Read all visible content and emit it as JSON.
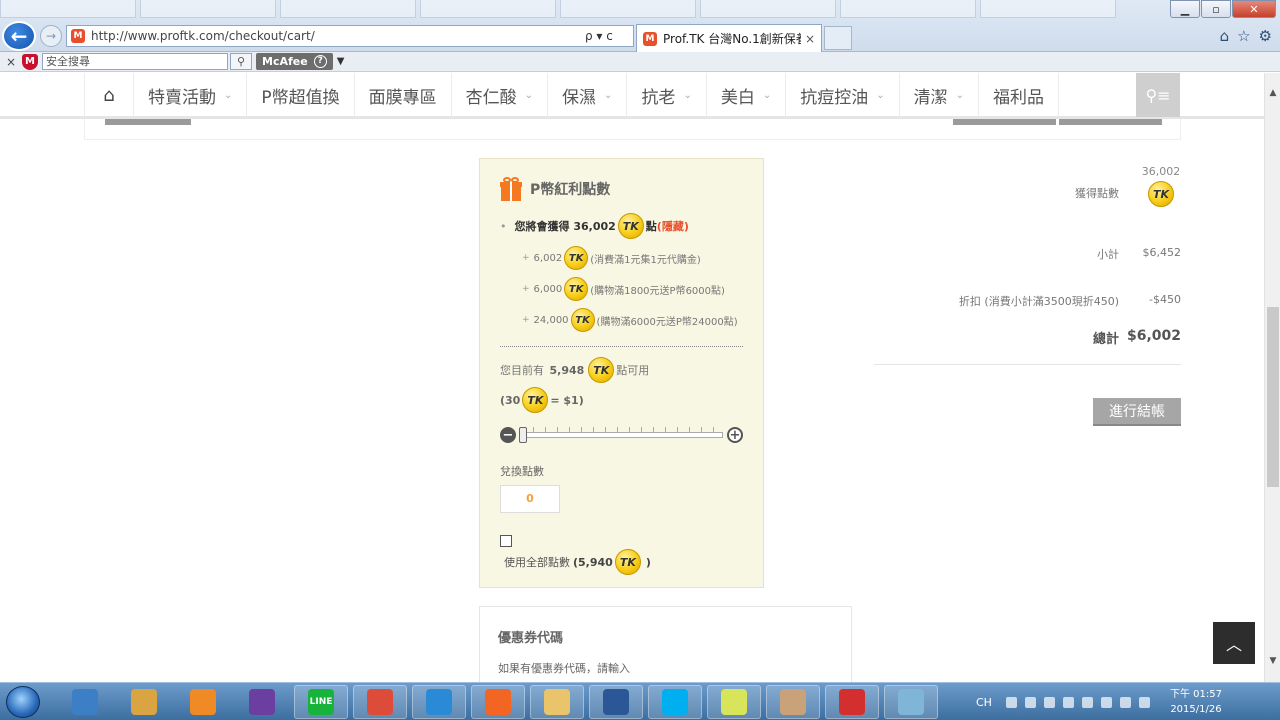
{
  "browser": {
    "address_url": "http://www.proftk.com/checkout/cart/",
    "address_controls": "ρ ▾ c",
    "tab_title": "Prof.TK 台灣No.1創新保養...",
    "tab_close": "×",
    "toolbar_close": "×",
    "safe_search_placeholder": "安全搜尋",
    "mcafee_label": "McAfee",
    "window_controls": {
      "minimize": "▁",
      "maximize": "▫",
      "close": "✕"
    },
    "tool_icons": [
      "home-icon",
      "star-icon",
      "gear-icon"
    ]
  },
  "site_nav": {
    "items": [
      {
        "label": "特賣活動",
        "has_dropdown": true
      },
      {
        "label": "P幣超值換",
        "has_dropdown": false
      },
      {
        "label": "面膜專區",
        "has_dropdown": false
      },
      {
        "label": "杏仁酸",
        "has_dropdown": true
      },
      {
        "label": "保濕",
        "has_dropdown": true
      },
      {
        "label": "抗老",
        "has_dropdown": true
      },
      {
        "label": "美白",
        "has_dropdown": true
      },
      {
        "label": "抗痘控油",
        "has_dropdown": true
      },
      {
        "label": "清潔",
        "has_dropdown": true
      },
      {
        "label": "福利品",
        "has_dropdown": false
      }
    ]
  },
  "coin_text": "TK",
  "points": {
    "title": "P幣紅利點數",
    "earn_prefix": "您將會獲得",
    "earn_amount": "36,002",
    "earn_unit": "點",
    "hide_open": "(",
    "hide_link": "隱藏",
    "hide_close": ")",
    "breakdown": [
      {
        "amount": "6,002",
        "note": "(消費滿1元集1元代購金)"
      },
      {
        "amount": "6,000",
        "note": "(購物滿1800元送P幣6000點)"
      },
      {
        "amount": "24,000",
        "note": "(購物滿6000元送P幣24000點)"
      }
    ],
    "available_prefix": "您目前有",
    "available_amount": "5,948",
    "available_suffix": "點可用",
    "rate_prefix": "(30",
    "rate_suffix": "= $1)",
    "slider_value": 0,
    "redeem_label": "兌換點數",
    "redeem_value": "0",
    "use_all_checked": false,
    "use_all_prefix": "使用全部點數",
    "use_all_amount": "(5,940",
    "use_all_close": ")"
  },
  "summary": {
    "earned_label": "獲得點數",
    "earned_value": "36,002",
    "subtotal_label": "小計",
    "subtotal_value": "$6,452",
    "discount_label": "折扣 (消費小計滿3500現折450)",
    "discount_value": "-$450",
    "total_label": "總計",
    "total_value": "$6,002",
    "checkout_label": "進行結帳"
  },
  "coupon": {
    "title": "優惠券代碼",
    "hint": "如果有優惠券代碼，請輸入"
  },
  "taskbar": {
    "lang": "CH",
    "time": "下午 01:57",
    "date": "2015/1/26",
    "apps": [
      "explorer",
      "paint-tool",
      "media-player",
      "visual-studio",
      "line",
      "chrome",
      "internet-explorer",
      "sublime",
      "file-manager",
      "word",
      "skype",
      "sticky-notes",
      "paint",
      "acrobat",
      "app"
    ],
    "line_label": "LINE"
  },
  "colors": {
    "accent_orange": "#f47920",
    "points_bg": "#f8f7e4",
    "coin_gold": "#f6cd15",
    "checkout_gray": "#a6a6a6"
  }
}
